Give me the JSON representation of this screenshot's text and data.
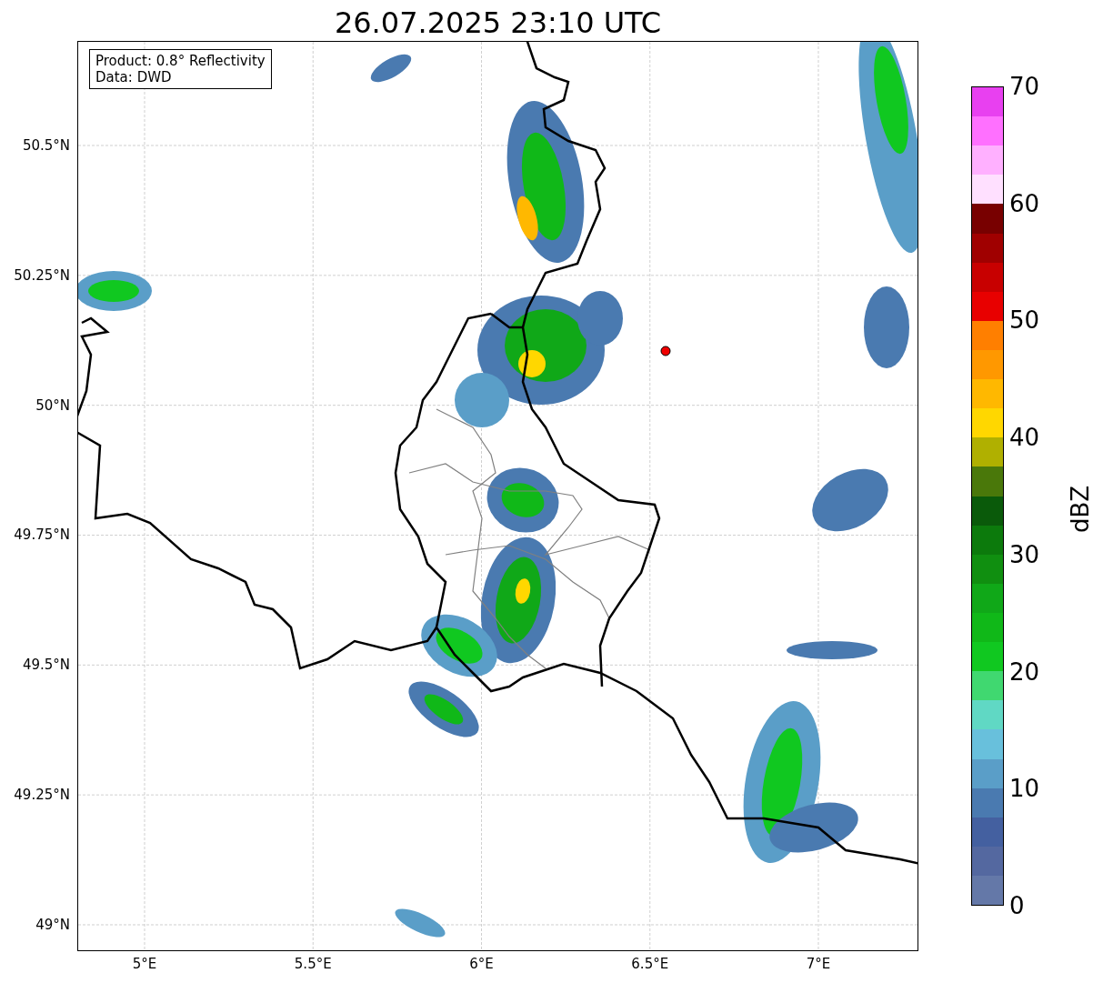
{
  "title": "26.07.2025 23:10 UTC",
  "info_box": {
    "lines": [
      "Product: 0.8° Reflectivity",
      "Data: DWD"
    ]
  },
  "lat_ticks": [
    "50.5°N",
    "50.25°N",
    "50°N",
    "49.75°N",
    "49.5°N",
    "49.25°N",
    "49°N"
  ],
  "lon_ticks": [
    "5°E",
    "5.5°E",
    "6°E",
    "6.5°E",
    "7°E"
  ],
  "colorbar": {
    "label": "dBZ",
    "ticks": [
      "70",
      "60",
      "50",
      "40",
      "30",
      "20",
      "10",
      "0"
    ],
    "bins": [
      {
        "color": "#e840f0"
      },
      {
        "color": "#ff70ff"
      },
      {
        "color": "#ffb0ff"
      },
      {
        "color": "#ffe0ff"
      },
      {
        "color": "#780000"
      },
      {
        "color": "#a00000"
      },
      {
        "color": "#c80000"
      },
      {
        "color": "#e80000"
      },
      {
        "color": "#ff7f00"
      },
      {
        "color": "#ff9800"
      },
      {
        "color": "#ffb800"
      },
      {
        "color": "#ffd700"
      },
      {
        "color": "#b0b000"
      },
      {
        "color": "#4a780a"
      },
      {
        "color": "#0a5a0a"
      },
      {
        "color": "#0c7a0c"
      },
      {
        "color": "#108f10"
      },
      {
        "color": "#10a818"
      },
      {
        "color": "#10b818"
      },
      {
        "color": "#10c820"
      },
      {
        "color": "#40d870"
      },
      {
        "color": "#60d8c4"
      },
      {
        "color": "#68c0dc"
      },
      {
        "color": "#5a9ec8"
      },
      {
        "color": "#4a7ab0"
      },
      {
        "color": "#4460a0"
      },
      {
        "color": "#5468a0"
      },
      {
        "color": "#6478a8"
      }
    ]
  }
}
